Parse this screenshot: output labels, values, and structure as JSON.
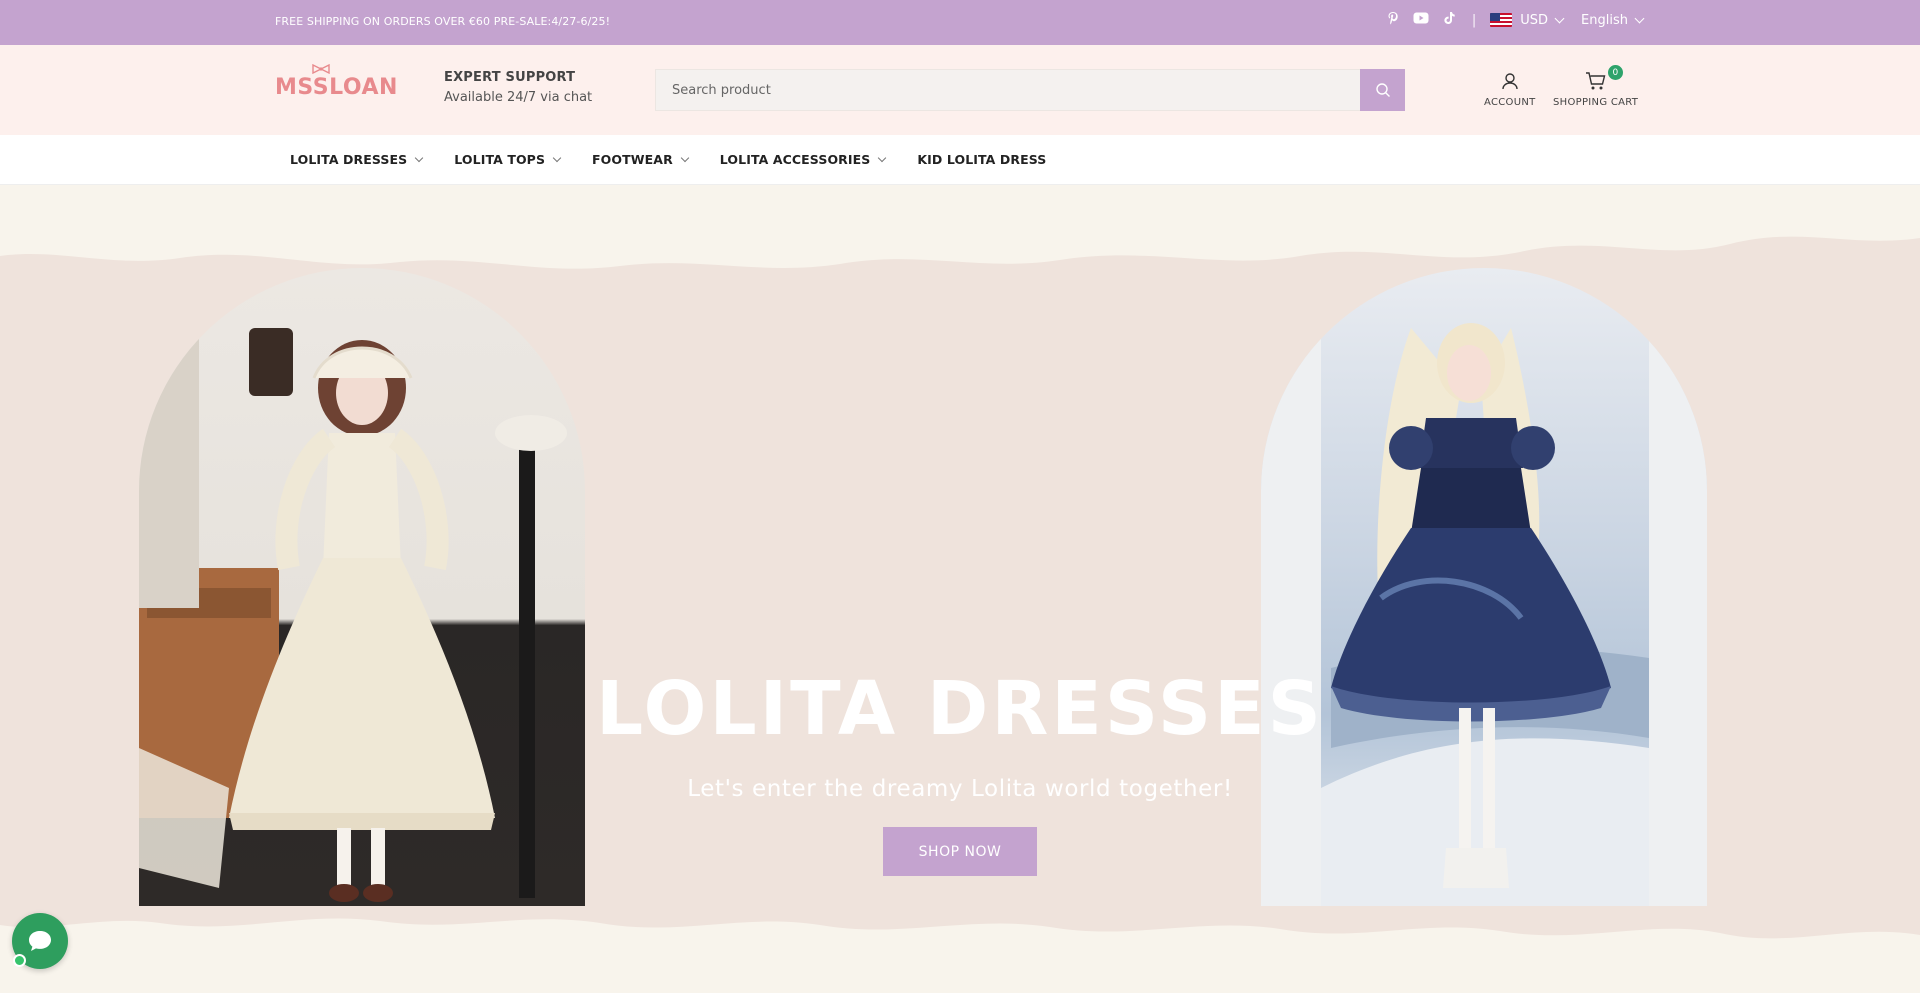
{
  "topbar": {
    "promo": "FREE SHIPPING ON ORDERS OVER €60 PRE-SALE:4/27-6/25!",
    "separator": "|",
    "currency": "USD",
    "language": "English",
    "social_icons": [
      "pinterest-icon",
      "youtube-icon",
      "tiktok-icon"
    ]
  },
  "header": {
    "logo": "MSSLOAN",
    "support_title": "EXPERT SUPPORT",
    "support_sub": "Available 24/7 via chat",
    "search_placeholder": "Search product",
    "account_label": "ACCOUNT",
    "cart_label": "SHOPPING CART",
    "cart_count": "0"
  },
  "nav": {
    "items": [
      {
        "label": "LOLITA DRESSES",
        "dropdown": true
      },
      {
        "label": "LOLITA TOPS",
        "dropdown": true
      },
      {
        "label": "FOOTWEAR",
        "dropdown": true
      },
      {
        "label": "LOLITA ACCESSORIES",
        "dropdown": true
      },
      {
        "label": "KID LOLITA DRESS",
        "dropdown": false
      }
    ]
  },
  "hero": {
    "title": "LOLITA DRESSES",
    "subtitle": "Let's enter the dreamy Lolita world together!",
    "cta": "SHOP NOW"
  },
  "colors": {
    "accent": "#c4a3cf",
    "header_bg": "#fdf0ed",
    "hero_bg": "#efe3dc",
    "logo": "#e88a8d",
    "chat": "#2e9e5e"
  }
}
